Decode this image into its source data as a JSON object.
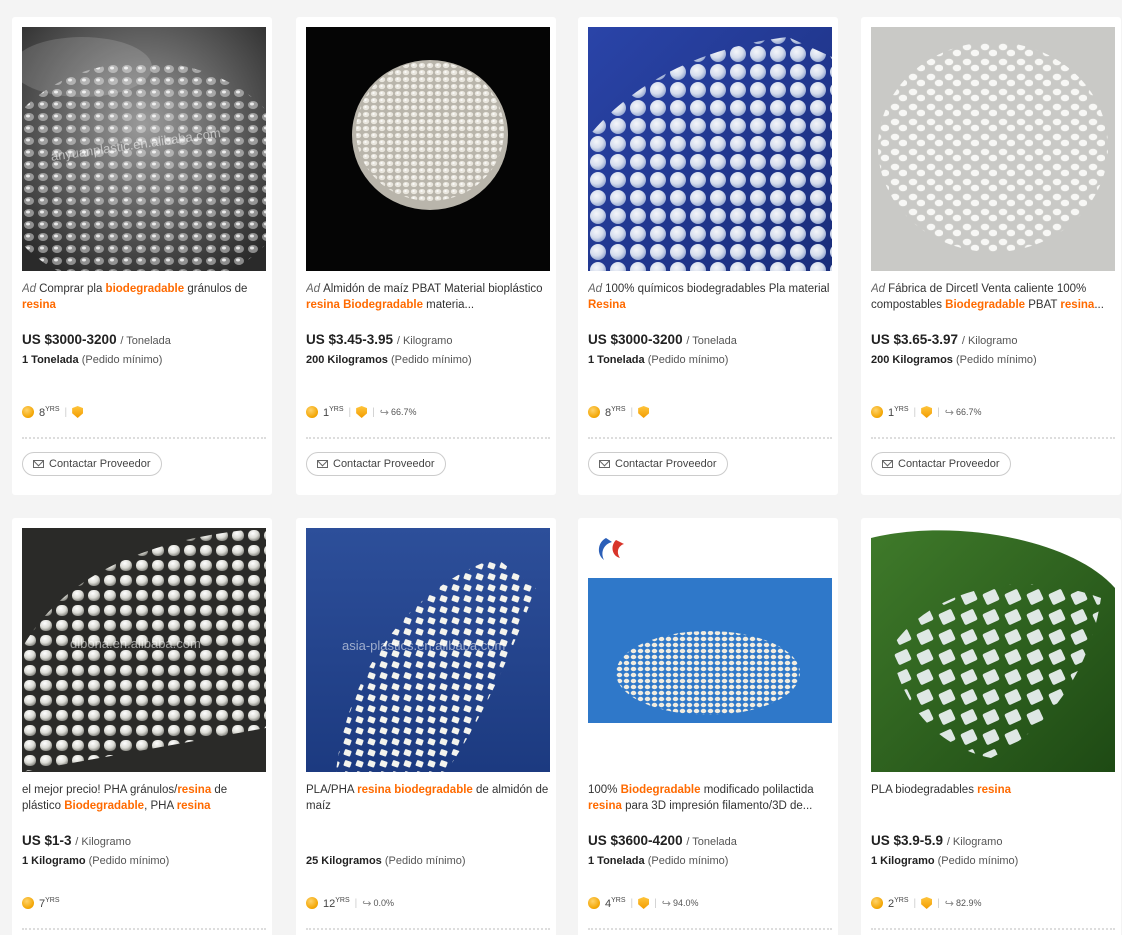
{
  "products": [
    {
      "ad": "Ad",
      "title_parts": [
        {
          "t": "Comprar pla ",
          "hl": false
        },
        {
          "t": "biodegradable",
          "hl": true
        },
        {
          "t": " gránulos de ",
          "hl": false
        },
        {
          "t": "resina",
          "hl": true
        }
      ],
      "price": "US $3000-3200",
      "unit": "/ Tonelada",
      "moq_qty": "1 Tonelada",
      "moq_label": "(Pedido mínimo)",
      "years": "8",
      "years_suffix": "YRS",
      "shield": true,
      "rate": "",
      "watermark": "anyuanplastic.en.alibaba.com",
      "contact": "Contactar Proveedor"
    },
    {
      "ad": "Ad",
      "title_parts": [
        {
          "t": "Almidón de maíz PBAT Material bioplástico ",
          "hl": false
        },
        {
          "t": "resina",
          "hl": true
        },
        {
          "t": " ",
          "hl": false
        },
        {
          "t": "Biodegradable",
          "hl": true
        },
        {
          "t": " materia...",
          "hl": false
        }
      ],
      "price": "US $3.45-3.95",
      "unit": "/ Kilogramo",
      "moq_qty": "200 Kilogramos",
      "moq_label": "(Pedido mínimo)",
      "years": "1",
      "years_suffix": "YRS",
      "shield": true,
      "rate": "66.7%",
      "watermark": "",
      "contact": "Contactar Proveedor"
    },
    {
      "ad": "Ad",
      "title_parts": [
        {
          "t": "100% químicos biodegradables Pla material ",
          "hl": false
        },
        {
          "t": "Resina",
          "hl": true
        }
      ],
      "price": "US $3000-3200",
      "unit": "/ Tonelada",
      "moq_qty": "1 Tonelada",
      "moq_label": "(Pedido mínimo)",
      "years": "8",
      "years_suffix": "YRS",
      "shield": true,
      "rate": "",
      "watermark": "",
      "contact": "Contactar Proveedor"
    },
    {
      "ad": "Ad",
      "title_parts": [
        {
          "t": "Fábrica de Dircetl Venta caliente 100% compostables ",
          "hl": false
        },
        {
          "t": "Biodegradable",
          "hl": true
        },
        {
          "t": " PBAT ",
          "hl": false
        },
        {
          "t": "resina",
          "hl": true
        },
        {
          "t": "...",
          "hl": false
        }
      ],
      "price": "US $3.65-3.97",
      "unit": "/ Kilogramo",
      "moq_qty": "200 Kilogramos",
      "moq_label": "(Pedido mínimo)",
      "years": "1",
      "years_suffix": "YRS",
      "shield": true,
      "rate": "66.7%",
      "watermark": "",
      "contact": "Contactar Proveedor"
    },
    {
      "ad": "",
      "title_parts": [
        {
          "t": "el mejor precio! PHA gránulos/",
          "hl": false
        },
        {
          "t": "resina",
          "hl": true
        },
        {
          "t": " de plástico ",
          "hl": false
        },
        {
          "t": "Biodegradable",
          "hl": true
        },
        {
          "t": ", PHA ",
          "hl": false
        },
        {
          "t": "resina",
          "hl": true
        }
      ],
      "price": "US $1-3",
      "unit": "/ Kilogramo",
      "moq_qty": "1 Kilogramo",
      "moq_label": "(Pedido mínimo)",
      "years": "7",
      "years_suffix": "YRS",
      "shield": false,
      "rate": "",
      "watermark": "dlbona.en.alibaba.com",
      "contact": ""
    },
    {
      "ad": "",
      "title_parts": [
        {
          "t": "PLA/PHA ",
          "hl": false
        },
        {
          "t": "resina biodegradable",
          "hl": true
        },
        {
          "t": " de almidón de maíz",
          "hl": false
        }
      ],
      "price": "",
      "unit": "",
      "moq_qty": "25 Kilogramos",
      "moq_label": "(Pedido mínimo)",
      "years": "12",
      "years_suffix": "YRS",
      "shield": false,
      "rate": "0.0%",
      "watermark": "asia-plastics.en.alibaba.com",
      "contact": ""
    },
    {
      "ad": "",
      "title_parts": [
        {
          "t": "100% ",
          "hl": false
        },
        {
          "t": "Biodegradable",
          "hl": true
        },
        {
          "t": " modificado polilactida ",
          "hl": false
        },
        {
          "t": "resina",
          "hl": true
        },
        {
          "t": " para 3D impresión filamento/3D de...",
          "hl": false
        }
      ],
      "price": "US $3600-4200",
      "unit": "/ Tonelada",
      "moq_qty": "1 Tonelada",
      "moq_label": "(Pedido mínimo)",
      "years": "4",
      "years_suffix": "YRS",
      "shield": true,
      "rate": "94.0%",
      "watermark": "",
      "contact": ""
    },
    {
      "ad": "",
      "title_parts": [
        {
          "t": "PLA biodegradables ",
          "hl": false
        },
        {
          "t": "resina",
          "hl": true
        }
      ],
      "price": "US $3.9-5.9",
      "unit": "/ Kilogramo",
      "moq_qty": "1 Kilogramo",
      "moq_label": "(Pedido mínimo)",
      "years": "2",
      "years_suffix": "YRS",
      "shield": true,
      "rate": "82.9%",
      "watermark": "",
      "contact": ""
    }
  ],
  "colors": {
    "highlight": "#ff6a00",
    "page_bg": "#f4f4f4",
    "card_bg": "#ffffff"
  },
  "icons": {
    "contact": "mail-icon",
    "years": "gold-supplier-coin-icon",
    "verified": "verified-shield-icon",
    "response": "reply-arrow-icon"
  }
}
